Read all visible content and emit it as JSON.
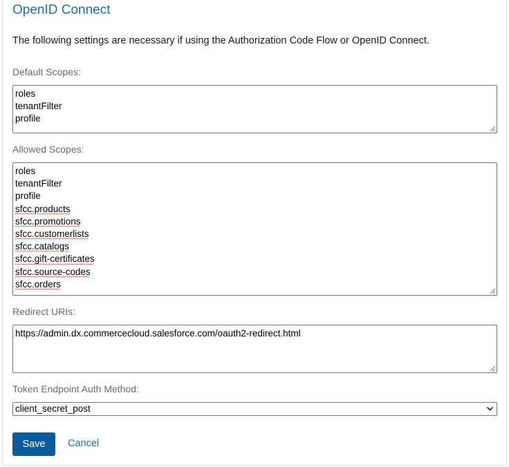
{
  "section": {
    "title": "OpenID Connect",
    "intro": "The following settings are necessary if using the Authorization Code Flow or OpenID Connect."
  },
  "default_scopes": {
    "label": "Default Scopes:",
    "lines": [
      "roles",
      "tenantFilter",
      "profile"
    ]
  },
  "allowed_scopes": {
    "label": "Allowed Scopes:",
    "lines": [
      "roles",
      "tenantFilter",
      "profile",
      "sfcc.products",
      "sfcc.promotions",
      "sfcc.customerlists",
      "sfcc.catalogs",
      "sfcc.gift-certificates",
      "sfcc.source-codes",
      "sfcc.orders"
    ]
  },
  "redirect_uris": {
    "label": "Redirect URIs:",
    "lines": [
      "https://admin.dx.commercecloud.salesforce.com/oauth2-redirect.html"
    ]
  },
  "token_auth": {
    "label": "Token Endpoint Auth Method:",
    "selected": "client_secret_post"
  },
  "actions": {
    "save_label": "Save",
    "cancel_label": "Cancel"
  },
  "colors": {
    "title": "#1f6fb5",
    "primary_button": "#0b5c9e",
    "link": "#1f6fb5",
    "spellcheck": "#d83b2f"
  }
}
